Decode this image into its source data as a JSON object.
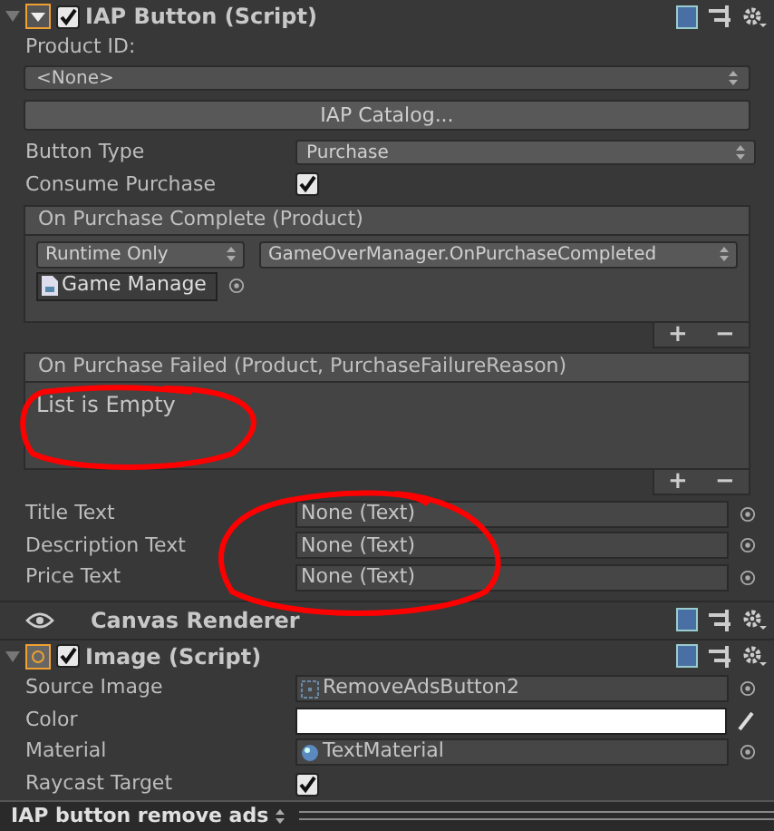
{
  "iap_component": {
    "title": "IAP Button (Script)",
    "expanded": true,
    "enabled": true,
    "product_id_label": "Product ID:",
    "product_id_value": "<None>",
    "catalog_button": "IAP Catalog...",
    "button_type": {
      "label": "Button Type",
      "value": "Purchase"
    },
    "consume_purchase": {
      "label": "Consume Purchase",
      "checked": true
    },
    "events": [
      {
        "title": "On Purchase Complete (Product)",
        "listeners": [
          {
            "runtime": "Runtime Only",
            "method": "GameOverManager.OnPurchaseCompleted",
            "object": "Game Manage"
          }
        ],
        "add": "+",
        "remove": "−"
      },
      {
        "title": "On Purchase Failed (Product, PurchaseFailureReason)",
        "empty_text": "List is Empty",
        "add": "+",
        "remove": "−"
      }
    ],
    "text_fields": [
      {
        "label": "Title Text",
        "value": "None (Text)"
      },
      {
        "label": "Description Text",
        "value": "None (Text)"
      },
      {
        "label": "Price Text",
        "value": "None (Text)"
      }
    ]
  },
  "canvas_renderer": {
    "title": "Canvas Renderer"
  },
  "image_component": {
    "title": "Image (Script)",
    "expanded": true,
    "enabled": true,
    "rows": [
      {
        "kind": "sprite",
        "label": "Source Image",
        "value": "RemoveAdsButton2"
      },
      {
        "kind": "color",
        "label": "Color",
        "color": "#ffffff"
      },
      {
        "kind": "material",
        "label": "Material",
        "value": "TextMaterial"
      },
      {
        "kind": "toggle",
        "label": "Raycast Target",
        "checked": true
      }
    ]
  },
  "footer": {
    "label": "IAP button remove ads"
  }
}
